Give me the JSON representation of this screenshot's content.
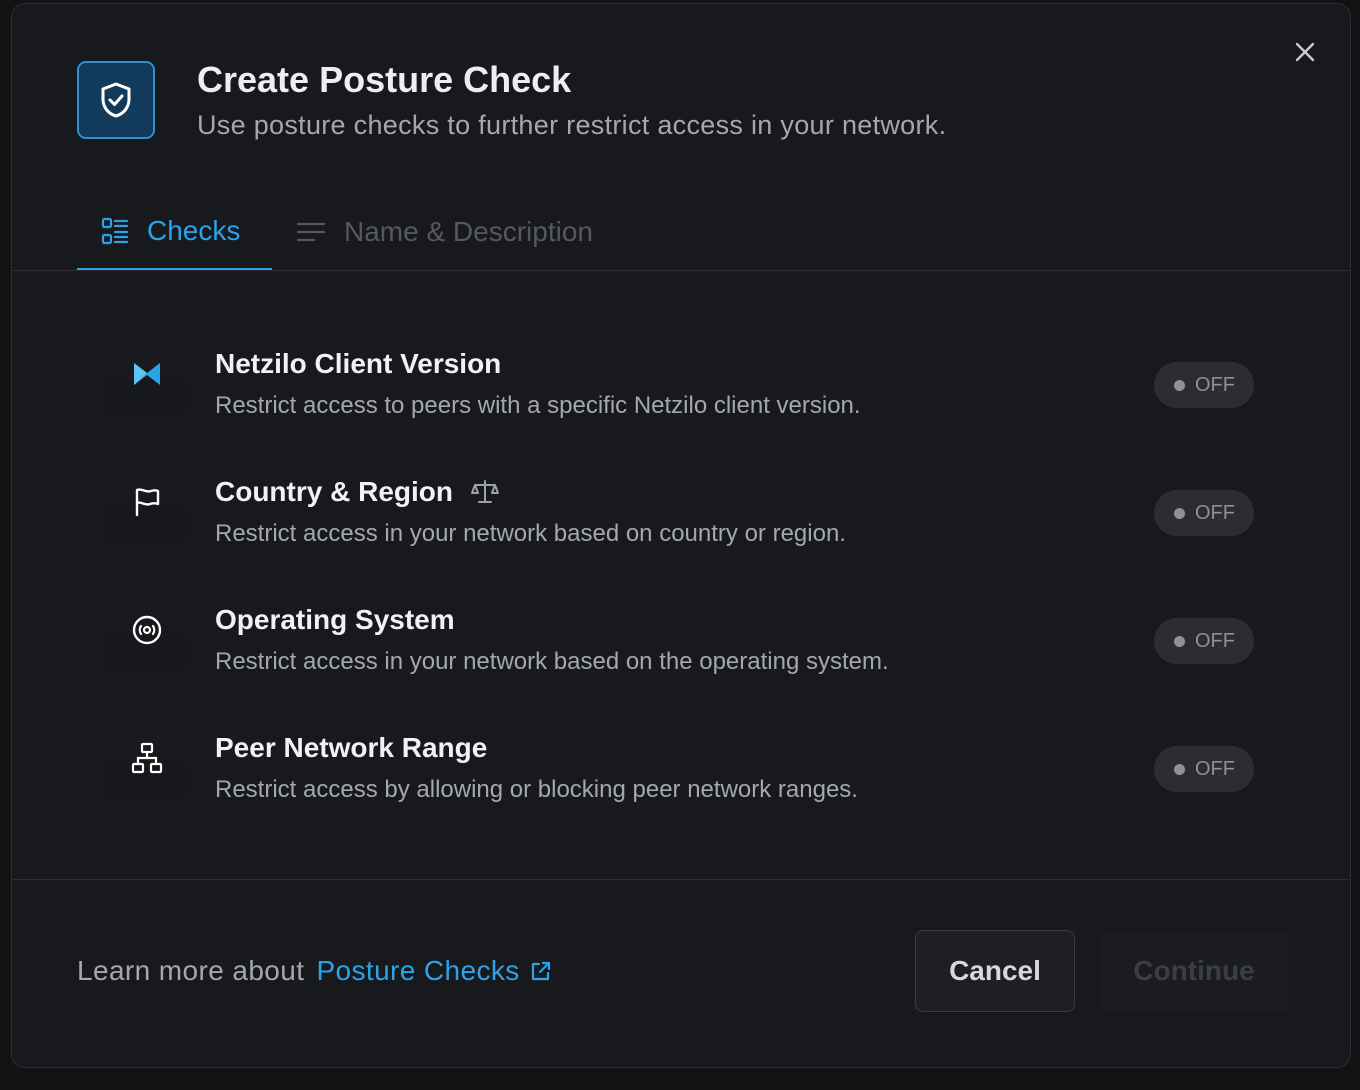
{
  "modal": {
    "title": "Create Posture Check",
    "subtitle": "Use posture checks to further restrict access in your network."
  },
  "tabs": [
    {
      "label": "Checks",
      "active": true
    },
    {
      "label": "Name & Description",
      "active": false
    }
  ],
  "checks": [
    {
      "icon": "netzilo-logo-icon",
      "title": "Netzilo Client Version",
      "description": "Restrict access to peers with a specific Netzilo client version.",
      "toggle": "OFF"
    },
    {
      "icon": "flag-icon",
      "title": "Country & Region",
      "extra_icon": "scale-icon",
      "description": "Restrict access in your network based on country or region.",
      "toggle": "OFF"
    },
    {
      "icon": "disc-icon",
      "title": "Operating System",
      "description": "Restrict access in your network based on the operating system.",
      "toggle": "OFF"
    },
    {
      "icon": "network-icon",
      "title": "Peer Network Range",
      "description": "Restrict access by allowing or blocking peer network ranges.",
      "toggle": "OFF"
    }
  ],
  "footer": {
    "learn_more_prefix": "Learn more about",
    "learn_more_link": "Posture Checks",
    "cancel_label": "Cancel",
    "continue_label": "Continue"
  },
  "colors": {
    "accent": "#2ba3e8",
    "background": "#18191c",
    "toggle_bg": "#2b2d32"
  }
}
